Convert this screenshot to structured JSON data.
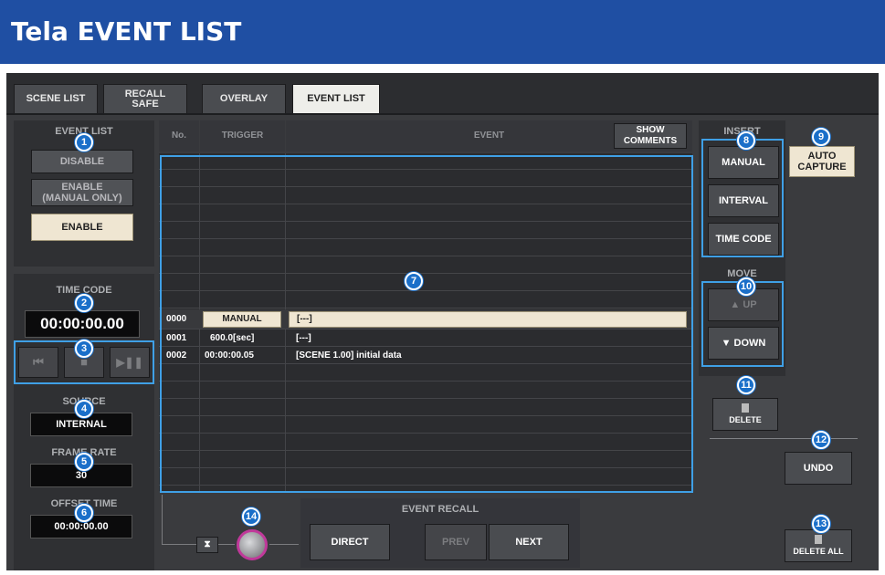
{
  "page_title": "Tela EVENT LIST",
  "tabs": [
    "SCENE LIST",
    "RECALL\nSAFE",
    "OVERLAY",
    "EVENT LIST"
  ],
  "event_list": {
    "label": "EVENT LIST",
    "disable": "DISABLE",
    "enable_manual": "ENABLE\n(MANUAL ONLY)",
    "enable": "ENABLE"
  },
  "time_code": {
    "label": "TIME CODE",
    "value": "00:00:00.00"
  },
  "transport": {
    "rewind": "⏮",
    "stop": "■",
    "play": "▶❚❚"
  },
  "source": {
    "label": "SOURCE",
    "value": "INTERNAL"
  },
  "frame_rate": {
    "label": "FRAME RATE",
    "value": "30"
  },
  "offset_time": {
    "label": "OFFSET TIME",
    "value": "00:00:00.00"
  },
  "table": {
    "col_no": "No.",
    "col_trigger": "TRIGGER",
    "col_event": "EVENT",
    "show_comments": "SHOW\nCOMMENTS",
    "rows": [
      {
        "no": "0000",
        "trigger": "MANUAL",
        "event": "[---]"
      },
      {
        "no": "0001",
        "trigger": "600.0[sec]",
        "event": "[---]"
      },
      {
        "no": "0002",
        "trigger": "00:00:00.05",
        "event": "[SCENE 1.00] initial data"
      }
    ]
  },
  "insert": {
    "label": "INSERT",
    "manual": "MANUAL",
    "interval": "INTERVAL",
    "time_code": "TIME CODE"
  },
  "auto_capture": "AUTO\nCAPTURE",
  "move": {
    "label": "MOVE",
    "up": "▲ UP",
    "down": "▼ DOWN"
  },
  "delete": "DELETE",
  "undo": "UNDO",
  "delete_all": "DELETE ALL",
  "event_recall": {
    "label": "EVENT RECALL",
    "direct": "DIRECT",
    "prev": "PREV",
    "next": "NEXT"
  },
  "callouts": [
    "1",
    "2",
    "3",
    "4",
    "5",
    "6",
    "7",
    "8",
    "9",
    "10",
    "11",
    "12",
    "13",
    "14"
  ],
  "colors": {
    "title_bar": "#1f4fa3",
    "callout": "#1a6fc9",
    "highlight": "#3fa0e6",
    "knob_ring": "#c0399a"
  }
}
